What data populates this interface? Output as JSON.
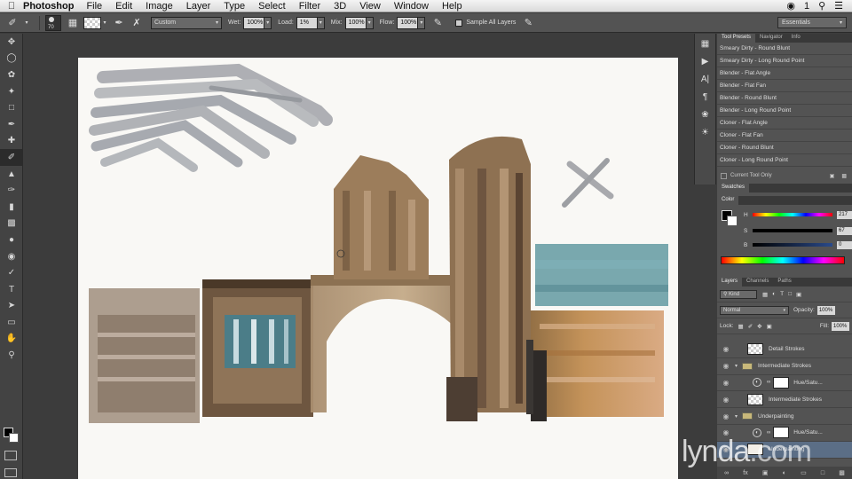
{
  "menubar": {
    "app": "Photoshop",
    "items": [
      "File",
      "Edit",
      "Image",
      "Layer",
      "Type",
      "Select",
      "Filter",
      "3D",
      "View",
      "Window",
      "Help"
    ],
    "badge": "1"
  },
  "options": {
    "brush_size": "70",
    "preset": "Custom",
    "wet_label": "Wet:",
    "wet": "100%",
    "load_label": "Load:",
    "load": "1%",
    "mix_label": "Mix:",
    "mix": "100%",
    "flow_label": "Flow:",
    "flow": "100%",
    "sample_all": "Sample All Layers",
    "workspace": "Essentials"
  },
  "tool_presets": {
    "tabs": [
      "Tool Presets",
      "Navigator",
      "Info"
    ],
    "items": [
      "Smeary Dirty - Round Blunt",
      "Smeary Dirty - Long Round Point",
      "Blender - Flat Angle",
      "Blender - Flat Fan",
      "Blender - Round Blunt",
      "Blender - Long Round Point",
      "Cloner - Flat Angle",
      "Cloner - Flat Fan",
      "Cloner - Round Blunt",
      "Cloner - Long Round Point"
    ],
    "current_tool_only": "Current Tool Only"
  },
  "swatches": {
    "tab": "Swatches"
  },
  "color": {
    "tab": "Color",
    "h_label": "H",
    "h": "217",
    "s_label": "S",
    "s": "67",
    "b_label": "B",
    "b": "0",
    "h_pct": "%",
    "s_pct": "%",
    "b_pct": "%"
  },
  "layers": {
    "tabs": [
      "Layers",
      "Channels",
      "Paths"
    ],
    "kind": "Kind",
    "blend": "Normal",
    "opacity_label": "Opacity:",
    "opacity": "100%",
    "lock_label": "Lock:",
    "fill_label": "Fill:",
    "fill": "100%",
    "list": [
      {
        "name": "Detail Strokes",
        "type": "pixel",
        "indent": 0
      },
      {
        "name": "Intermediate Strokes",
        "type": "group",
        "indent": 0
      },
      {
        "name": "Hue/Satu...",
        "type": "adjustment",
        "indent": 1
      },
      {
        "name": "Intermediate Strokes",
        "type": "pixel",
        "indent": 1
      },
      {
        "name": "Underpainting",
        "type": "group",
        "indent": 0
      },
      {
        "name": "Hue/Satu...",
        "type": "adjustment",
        "indent": 1
      },
      {
        "name": "Underpainting",
        "type": "pixel",
        "indent": 1
      }
    ]
  },
  "watermark": {
    "text": "lynda",
    "suffix": ".com"
  }
}
